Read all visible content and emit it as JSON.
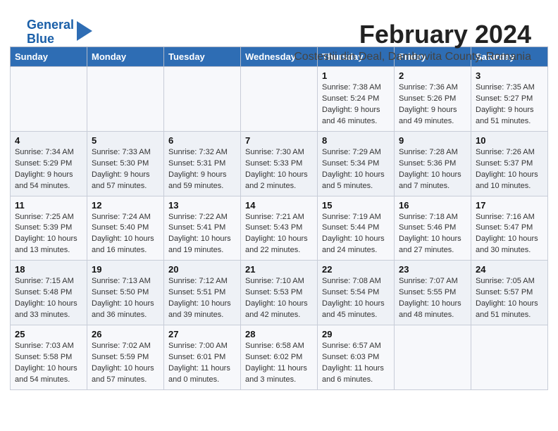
{
  "logo": {
    "line1": "General",
    "line2": "Blue"
  },
  "header": {
    "title": "February 2024",
    "subtitle": "Costestii din Deal, Dambovita County, Romania"
  },
  "weekdays": [
    "Sunday",
    "Monday",
    "Tuesday",
    "Wednesday",
    "Thursday",
    "Friday",
    "Saturday"
  ],
  "weeks": [
    [
      {
        "day": "",
        "info": ""
      },
      {
        "day": "",
        "info": ""
      },
      {
        "day": "",
        "info": ""
      },
      {
        "day": "",
        "info": ""
      },
      {
        "day": "1",
        "info": "Sunrise: 7:38 AM\nSunset: 5:24 PM\nDaylight: 9 hours\nand 46 minutes."
      },
      {
        "day": "2",
        "info": "Sunrise: 7:36 AM\nSunset: 5:26 PM\nDaylight: 9 hours\nand 49 minutes."
      },
      {
        "day": "3",
        "info": "Sunrise: 7:35 AM\nSunset: 5:27 PM\nDaylight: 9 hours\nand 51 minutes."
      }
    ],
    [
      {
        "day": "4",
        "info": "Sunrise: 7:34 AM\nSunset: 5:29 PM\nDaylight: 9 hours\nand 54 minutes."
      },
      {
        "day": "5",
        "info": "Sunrise: 7:33 AM\nSunset: 5:30 PM\nDaylight: 9 hours\nand 57 minutes."
      },
      {
        "day": "6",
        "info": "Sunrise: 7:32 AM\nSunset: 5:31 PM\nDaylight: 9 hours\nand 59 minutes."
      },
      {
        "day": "7",
        "info": "Sunrise: 7:30 AM\nSunset: 5:33 PM\nDaylight: 10 hours\nand 2 minutes."
      },
      {
        "day": "8",
        "info": "Sunrise: 7:29 AM\nSunset: 5:34 PM\nDaylight: 10 hours\nand 5 minutes."
      },
      {
        "day": "9",
        "info": "Sunrise: 7:28 AM\nSunset: 5:36 PM\nDaylight: 10 hours\nand 7 minutes."
      },
      {
        "day": "10",
        "info": "Sunrise: 7:26 AM\nSunset: 5:37 PM\nDaylight: 10 hours\nand 10 minutes."
      }
    ],
    [
      {
        "day": "11",
        "info": "Sunrise: 7:25 AM\nSunset: 5:39 PM\nDaylight: 10 hours\nand 13 minutes."
      },
      {
        "day": "12",
        "info": "Sunrise: 7:24 AM\nSunset: 5:40 PM\nDaylight: 10 hours\nand 16 minutes."
      },
      {
        "day": "13",
        "info": "Sunrise: 7:22 AM\nSunset: 5:41 PM\nDaylight: 10 hours\nand 19 minutes."
      },
      {
        "day": "14",
        "info": "Sunrise: 7:21 AM\nSunset: 5:43 PM\nDaylight: 10 hours\nand 22 minutes."
      },
      {
        "day": "15",
        "info": "Sunrise: 7:19 AM\nSunset: 5:44 PM\nDaylight: 10 hours\nand 24 minutes."
      },
      {
        "day": "16",
        "info": "Sunrise: 7:18 AM\nSunset: 5:46 PM\nDaylight: 10 hours\nand 27 minutes."
      },
      {
        "day": "17",
        "info": "Sunrise: 7:16 AM\nSunset: 5:47 PM\nDaylight: 10 hours\nand 30 minutes."
      }
    ],
    [
      {
        "day": "18",
        "info": "Sunrise: 7:15 AM\nSunset: 5:48 PM\nDaylight: 10 hours\nand 33 minutes."
      },
      {
        "day": "19",
        "info": "Sunrise: 7:13 AM\nSunset: 5:50 PM\nDaylight: 10 hours\nand 36 minutes."
      },
      {
        "day": "20",
        "info": "Sunrise: 7:12 AM\nSunset: 5:51 PM\nDaylight: 10 hours\nand 39 minutes."
      },
      {
        "day": "21",
        "info": "Sunrise: 7:10 AM\nSunset: 5:53 PM\nDaylight: 10 hours\nand 42 minutes."
      },
      {
        "day": "22",
        "info": "Sunrise: 7:08 AM\nSunset: 5:54 PM\nDaylight: 10 hours\nand 45 minutes."
      },
      {
        "day": "23",
        "info": "Sunrise: 7:07 AM\nSunset: 5:55 PM\nDaylight: 10 hours\nand 48 minutes."
      },
      {
        "day": "24",
        "info": "Sunrise: 7:05 AM\nSunset: 5:57 PM\nDaylight: 10 hours\nand 51 minutes."
      }
    ],
    [
      {
        "day": "25",
        "info": "Sunrise: 7:03 AM\nSunset: 5:58 PM\nDaylight: 10 hours\nand 54 minutes."
      },
      {
        "day": "26",
        "info": "Sunrise: 7:02 AM\nSunset: 5:59 PM\nDaylight: 10 hours\nand 57 minutes."
      },
      {
        "day": "27",
        "info": "Sunrise: 7:00 AM\nSunset: 6:01 PM\nDaylight: 11 hours\nand 0 minutes."
      },
      {
        "day": "28",
        "info": "Sunrise: 6:58 AM\nSunset: 6:02 PM\nDaylight: 11 hours\nand 3 minutes."
      },
      {
        "day": "29",
        "info": "Sunrise: 6:57 AM\nSunset: 6:03 PM\nDaylight: 11 hours\nand 6 minutes."
      },
      {
        "day": "",
        "info": ""
      },
      {
        "day": "",
        "info": ""
      }
    ]
  ]
}
